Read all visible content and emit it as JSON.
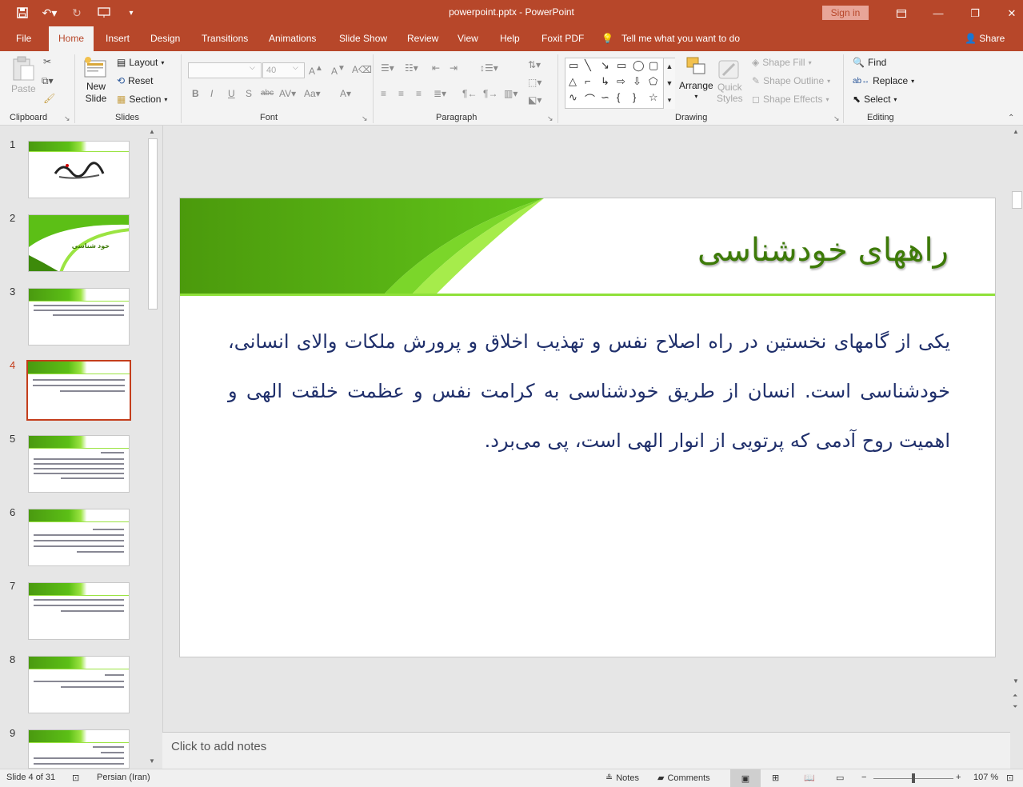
{
  "window": {
    "title": "powerpoint.pptx  -  PowerPoint",
    "sign_in": "Sign in"
  },
  "tabs": [
    "File",
    "Home",
    "Insert",
    "Design",
    "Transitions",
    "Animations",
    "Slide Show",
    "Review",
    "View",
    "Help",
    "Foxit PDF"
  ],
  "active_tab": "Home",
  "tell_me": "Tell me what you want to do",
  "share": "Share",
  "ribbon": {
    "clipboard": {
      "label": "Clipboard",
      "paste": "Paste"
    },
    "slides": {
      "label": "Slides",
      "new_slide_1": "New",
      "new_slide_2": "Slide",
      "layout": "Layout",
      "reset": "Reset",
      "section": "Section"
    },
    "font": {
      "label": "Font",
      "font_name": "",
      "font_size": "40"
    },
    "paragraph": {
      "label": "Paragraph"
    },
    "drawing": {
      "label": "Drawing",
      "arrange": "Arrange",
      "quick_styles_1": "Quick",
      "quick_styles_2": "Styles",
      "shape_fill": "Shape Fill",
      "shape_outline": "Shape Outline",
      "shape_effects": "Shape Effects"
    },
    "editing": {
      "label": "Editing",
      "find": "Find",
      "replace": "Replace",
      "select": "Select"
    }
  },
  "thumbnails": {
    "numbers": [
      "1",
      "2",
      "3",
      "4",
      "5",
      "6",
      "7",
      "8",
      "9"
    ],
    "selected": "4",
    "slide2_title": "خود شناسی"
  },
  "slide": {
    "title": "راههای خودشناسی",
    "body": "یکی از گامهای نخستین در راه اصلاح نفس و تهذیب اخلاق و پرورش ملکات والای انسانی، خودشناسی است. انسان از طریق خودشناسی به کرامت نفس و عظمت خلقت الهی و اهمیت روح آدمی که پرتویی از انوار الهی است، پی می‌برد."
  },
  "notes_placeholder": "Click to add notes",
  "status": {
    "slide_count": "Slide 4 of 31",
    "language": "Persian (Iran)",
    "notes": "Notes",
    "comments": "Comments",
    "zoom": "107 %"
  },
  "colors": {
    "accent": "#b7472a",
    "title_green": "#3d7a08",
    "body_blue": "#1f2f6b",
    "selection": "#c43e1c"
  }
}
